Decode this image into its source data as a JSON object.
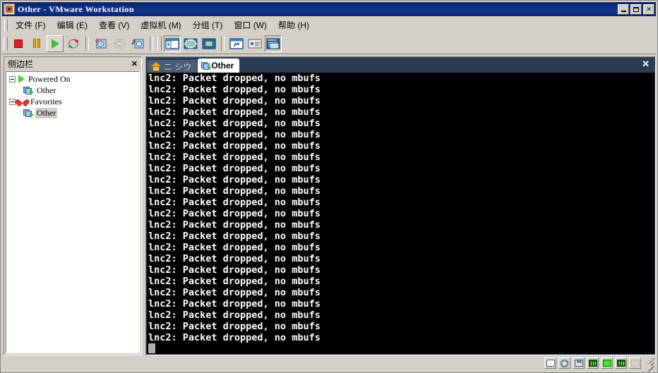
{
  "window": {
    "title": "Other - VMware Workstation",
    "icon": "vmware-icon",
    "buttons": {
      "minimize": "minimize-button",
      "maximize": "maximize-button",
      "close_label": "✕"
    }
  },
  "menubar": {
    "items": [
      {
        "label": "文件 (F)",
        "name": "menu-file"
      },
      {
        "label": "编辑 (E)",
        "name": "menu-edit"
      },
      {
        "label": "查看 (V)",
        "name": "menu-view"
      },
      {
        "label": "虚拟机 (M)",
        "name": "menu-vm"
      },
      {
        "label": "分组 (T)",
        "name": "menu-team"
      },
      {
        "label": "窗口 (W)",
        "name": "menu-window"
      },
      {
        "label": "帮助 (H)",
        "name": "menu-help"
      }
    ]
  },
  "toolbar": {
    "buttons": [
      {
        "name": "power-off-button",
        "icon": "stop-icon",
        "state": "normal"
      },
      {
        "name": "suspend-button",
        "icon": "pause-icon",
        "state": "normal"
      },
      {
        "name": "power-on-button",
        "icon": "play-icon",
        "state": "hot"
      },
      {
        "name": "reset-button",
        "icon": "reset-icon",
        "state": "normal"
      },
      {
        "name": "take-snapshot-button",
        "icon": "snapshot-add-icon",
        "state": "normal"
      },
      {
        "name": "revert-snapshot-button",
        "icon": "snapshot-revert-icon",
        "state": "disabled"
      },
      {
        "name": "snapshot-manager-button",
        "icon": "snapshot-manager-icon",
        "state": "normal"
      },
      {
        "name": "show-sidebar-button",
        "icon": "sidebar-icon",
        "state": "sunken"
      },
      {
        "name": "fullscreen-button",
        "icon": "fullscreen-icon",
        "state": "normal"
      },
      {
        "name": "quick-switch-button",
        "icon": "quick-switch-icon",
        "state": "normal"
      },
      {
        "name": "vm-settings-button",
        "icon": "wrench-window-icon",
        "state": "normal"
      },
      {
        "name": "vm-summary-button",
        "icon": "summary-icon",
        "state": "normal"
      },
      {
        "name": "show-console-button",
        "icon": "console-view-icon",
        "state": "sunken"
      }
    ]
  },
  "sidebar": {
    "title": "侧边栏",
    "close_label": "✕",
    "groups": [
      {
        "name": "sidebar-group-powered-on",
        "label": "Powered On",
        "icon": "play-icon",
        "expanded": true,
        "children": [
          {
            "label": "Other",
            "icon": "vm-icon",
            "selected": false
          }
        ]
      },
      {
        "name": "sidebar-group-favorites",
        "label": "Favorites",
        "icon": "heart-icon",
        "expanded": true,
        "children": [
          {
            "label": "Other",
            "icon": "vm-icon",
            "selected": true
          }
        ]
      }
    ]
  },
  "tabs": {
    "close_label": "✕",
    "items": [
      {
        "name": "tab-home",
        "label": "ニ  シウ",
        "icon": "home-icon",
        "active": false
      },
      {
        "name": "tab-other",
        "label": "Other",
        "icon": "vm-icon",
        "active": true
      }
    ]
  },
  "console": {
    "line_text": "lnc2: Packet dropped, no mbufs",
    "line_count": 24,
    "background": "#000000",
    "foreground": "#ffffff",
    "cursor": "block"
  },
  "statusbar": {
    "devices": [
      {
        "name": "status-device-harddisk",
        "icon": "harddisk-icon",
        "active": false
      },
      {
        "name": "status-device-cdrom",
        "icon": "cdrom-icon",
        "active": false
      },
      {
        "name": "status-device-floppy",
        "icon": "floppy-icon",
        "active": false
      },
      {
        "name": "status-device-network1",
        "icon": "network-icon",
        "active": false
      },
      {
        "name": "status-device-network2",
        "icon": "network-icon",
        "active": true
      },
      {
        "name": "status-device-network3",
        "icon": "network-icon",
        "active": false
      },
      {
        "name": "status-device-usb",
        "icon": "usb-icon",
        "active": false
      }
    ]
  },
  "colors": {
    "titlebar": "#0a246a",
    "face": "#d4d0c8",
    "tabbar": "#2b3c55",
    "console_bg": "#000000",
    "network_active": "#22e022"
  }
}
